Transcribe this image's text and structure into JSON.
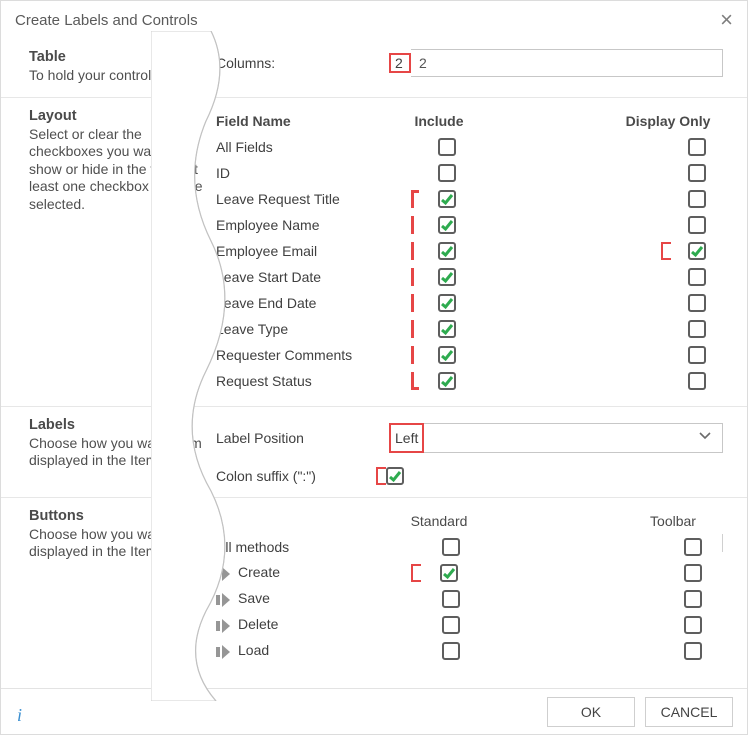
{
  "dialog": {
    "title": "Create Labels and Controls",
    "close_label": "×"
  },
  "sections": {
    "table": {
      "heading": "Table",
      "desc": "To hold your controls and"
    },
    "layout": {
      "heading": "Layout",
      "desc": "Select or clear the checkboxes you want to show or hide in the view. At least one checkbox must be selected."
    },
    "labels": {
      "heading": "Labels",
      "desc": "Choose how you want them displayed in the Item View."
    },
    "buttons": {
      "heading": "Buttons",
      "desc": "Choose how you want them displayed in the Item View."
    }
  },
  "columns": {
    "label": "Columns:",
    "value": "2"
  },
  "fields": {
    "name_header": "Field Name",
    "include_header": "Include",
    "display_header": "Display Only",
    "rows": [
      {
        "name": "All Fields",
        "include": false,
        "display": false
      },
      {
        "name": "ID",
        "include": false,
        "display": false
      },
      {
        "name": "Leave Request Title",
        "include": true,
        "display": false
      },
      {
        "name": "Employee Name",
        "include": true,
        "display": false
      },
      {
        "name": "Employee Email",
        "include": true,
        "display": true
      },
      {
        "name": "Leave Start Date",
        "include": true,
        "display": false
      },
      {
        "name": "Leave End Date",
        "include": true,
        "display": false
      },
      {
        "name": "Leave Type",
        "include": true,
        "display": false
      },
      {
        "name": "Requester Comments",
        "include": true,
        "display": false
      },
      {
        "name": "Request Status",
        "include": true,
        "display": false
      }
    ]
  },
  "label_position": {
    "label": "Label Position",
    "value": "Left"
  },
  "colon_suffix": {
    "label": "Colon suffix (\":\")",
    "checked": true
  },
  "methods": {
    "standard_header": "Standard",
    "toolbar_header": "Toolbar",
    "rows": [
      {
        "name": "All methods",
        "icon": false,
        "standard": false,
        "toolbar": false
      },
      {
        "name": "Create",
        "icon": true,
        "standard": true,
        "toolbar": false
      },
      {
        "name": "Save",
        "icon": true,
        "standard": false,
        "toolbar": false
      },
      {
        "name": "Delete",
        "icon": true,
        "standard": false,
        "toolbar": false
      },
      {
        "name": "Load",
        "icon": true,
        "standard": false,
        "toolbar": false
      }
    ]
  },
  "footer": {
    "ok": "OK",
    "cancel": "CANCEL",
    "info": "i"
  },
  "highlight": {
    "include_bracket_rows": {
      "start": 2,
      "end": 9
    },
    "display_bracket_row": 4,
    "create_bracket_row": 1
  }
}
